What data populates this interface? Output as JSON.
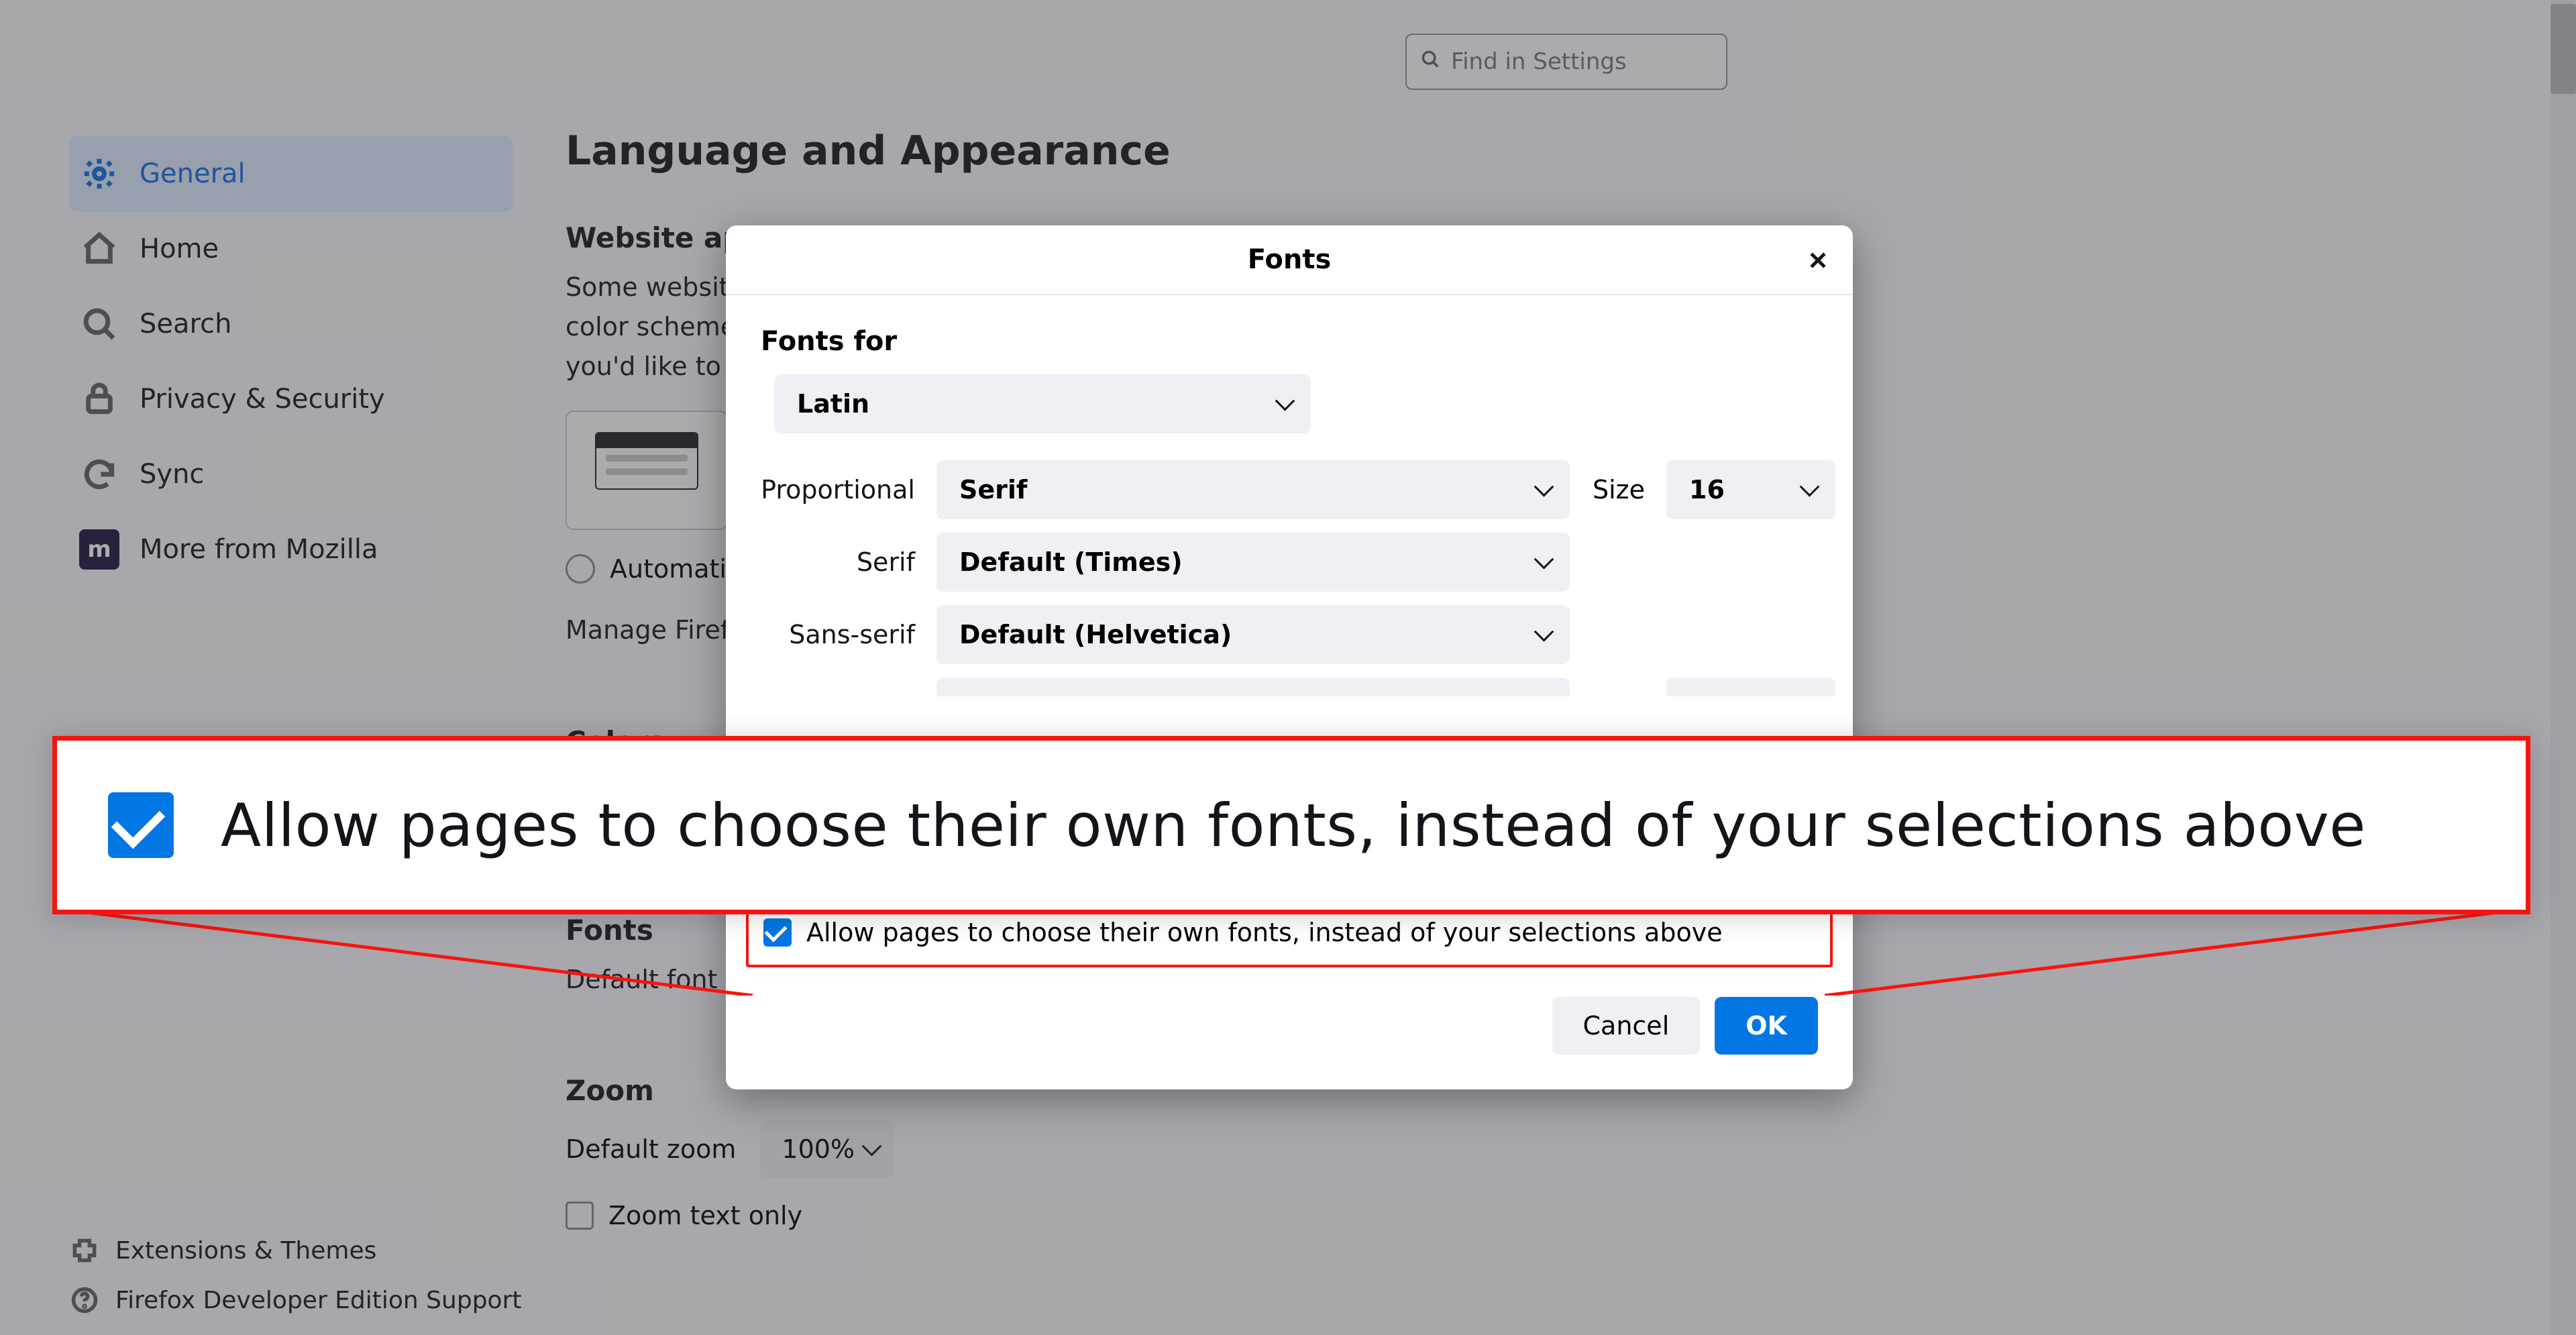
{
  "search": {
    "placeholder": "Find in Settings"
  },
  "sidebar": {
    "items": [
      {
        "label": "General"
      },
      {
        "label": "Home"
      },
      {
        "label": "Search"
      },
      {
        "label": "Privacy & Security"
      },
      {
        "label": "Sync"
      },
      {
        "label": "More from Mozilla"
      }
    ],
    "footer": [
      {
        "label": "Extensions & Themes"
      },
      {
        "label": "Firefox Developer Edition Support"
      }
    ]
  },
  "main": {
    "heading": "Language and Appearance",
    "appearance": {
      "title": "Website appearance",
      "desc_line1": "Some websites adapt their color scheme based on your preferences. Choose which color scheme",
      "desc_line2": "you'd like to use for those sites.",
      "radio_auto": "Automatic",
      "manage": "Manage Firefox themes"
    },
    "colors": {
      "title": "Colors"
    },
    "fonts": {
      "title": "Fonts",
      "default_font_label": "Default font"
    },
    "zoom": {
      "title": "Zoom",
      "default_zoom_label": "Default zoom",
      "default_zoom_value": "100%",
      "text_only_label": "Zoom text only"
    }
  },
  "modal": {
    "title": "Fonts",
    "fonts_for_label": "Fonts for",
    "fonts_for_value": "Latin",
    "proportional_label": "Proportional",
    "proportional_value": "Serif",
    "size_label": "Size",
    "size_value": "16",
    "serif_label": "Serif",
    "serif_value": "Default (Times)",
    "sans_label": "Sans-serif",
    "sans_value": "Default (Helvetica)",
    "allow_label": "Allow pages to choose their own fonts, instead of your selections above",
    "cancel": "Cancel",
    "ok": "OK"
  },
  "callout": {
    "text": "Allow pages to choose their own fonts, instead of your selections above"
  }
}
